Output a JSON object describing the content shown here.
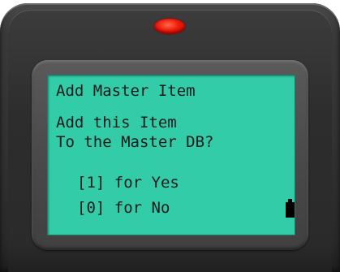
{
  "screen": {
    "title": "Add Master Item",
    "question_line1": "Add this Item",
    "question_line2": "To the Master DB?",
    "option_yes": "[1] for Yes",
    "option_no": "[0] for No"
  },
  "status": {
    "battery_icon": "battery-icon"
  },
  "colors": {
    "screen_background": "#33cca8",
    "indicator_led": "#ee1a0a",
    "device_body": "#303030",
    "text": "#1a1a1a"
  }
}
